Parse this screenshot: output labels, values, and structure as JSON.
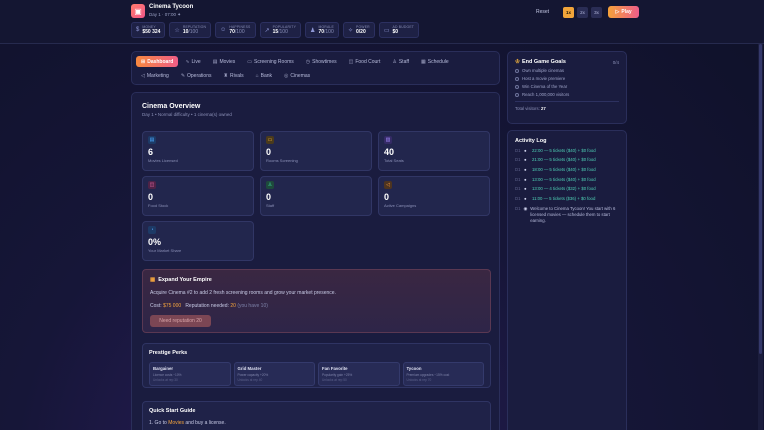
{
  "app": {
    "title": "Cinema Tycoon",
    "subtitle": "Day 1 · 07:00 ✦",
    "logo_icon": "clapperboard-icon"
  },
  "stats": [
    {
      "icon": "money-icon",
      "glyph": "$",
      "label": "MONEY",
      "value": "$50 324",
      "max": ""
    },
    {
      "icon": "star-icon",
      "glyph": "☆",
      "label": "REPUTATION",
      "value": "10",
      "max": "/100"
    },
    {
      "icon": "smile-icon",
      "glyph": "☺",
      "label": "HAPPINESS",
      "value": "70",
      "max": "/100"
    },
    {
      "icon": "trend-icon",
      "glyph": "↗",
      "label": "POPULARITY",
      "value": "15",
      "max": "/100"
    },
    {
      "icon": "morale-icon",
      "glyph": "♟",
      "label": "MORALE",
      "value": "70",
      "max": "/100"
    },
    {
      "icon": "power-icon",
      "glyph": "✧",
      "label": "POWER",
      "value": "0/20",
      "max": ""
    },
    {
      "icon": "budget-icon",
      "glyph": "▭",
      "label": "AD BUDGET",
      "value": "$0",
      "max": ""
    }
  ],
  "controls": {
    "reset": "Reset",
    "speeds": [
      "1x",
      "2x",
      "3x"
    ],
    "active_speed": "1x",
    "play": "Play"
  },
  "nav": {
    "row1": [
      {
        "id": "dashboard",
        "label": "Dashboard",
        "glyph": "⊞",
        "active": true
      },
      {
        "id": "live",
        "label": "Live",
        "glyph": "∿"
      },
      {
        "id": "movies",
        "label": "Movies",
        "glyph": "▤"
      },
      {
        "id": "screening-rooms",
        "label": "Screening Rooms",
        "glyph": "▭"
      },
      {
        "id": "showtimes",
        "label": "Showtimes",
        "glyph": "◷"
      },
      {
        "id": "food-court",
        "label": "Food Court",
        "glyph": "◫"
      },
      {
        "id": "staff",
        "label": "Staff",
        "glyph": "♙"
      },
      {
        "id": "schedule",
        "label": "Schedule",
        "glyph": "▦"
      }
    ],
    "row2": [
      {
        "id": "marketing",
        "label": "Marketing",
        "glyph": "◁"
      },
      {
        "id": "operations",
        "label": "Operations",
        "glyph": "✎"
      },
      {
        "id": "rivals",
        "label": "Rivals",
        "glyph": "♜"
      },
      {
        "id": "bank",
        "label": "Bank",
        "glyph": "⌂"
      },
      {
        "id": "cinemas",
        "label": "Cinemas",
        "glyph": "◎"
      }
    ]
  },
  "overview": {
    "title": "Cinema Overview",
    "subtitle": "Day 1 • Normal difficulty • 1 cinema(s) owned",
    "cards": [
      {
        "icon": "film-icon",
        "glyph": "▤",
        "color": "#4aa8ff",
        "value": "6",
        "label": "Movies Licensed"
      },
      {
        "icon": "screen-icon",
        "glyph": "▭",
        "color": "#f5b53d",
        "value": "0",
        "label": "Rooms Screening"
      },
      {
        "icon": "seats-icon",
        "glyph": "▥",
        "color": "#a58bff",
        "value": "40",
        "label": "Total Seats"
      },
      {
        "icon": "food-icon",
        "glyph": "◫",
        "color": "#ff6fb0",
        "value": "0",
        "label": "Food Stock"
      },
      {
        "icon": "staff-icon",
        "glyph": "♙",
        "color": "#3fd19a",
        "value": "0",
        "label": "Staff"
      },
      {
        "icon": "megaphone-icon",
        "glyph": "◁",
        "color": "#ff9a3d",
        "value": "0",
        "label": "Active Campaigns"
      },
      {
        "icon": "market-icon",
        "glyph": "◔",
        "color": "#5aa8ff",
        "value": "0%",
        "label": "Your Market Share"
      }
    ]
  },
  "expand": {
    "title": "Expand Your Empire",
    "description": "Acquire Cinema #2 to add 2 fresh screening rooms and grow your market presence.",
    "cost_label": "Cost:",
    "cost_value": "$75 000",
    "rep_label": "Reputation needed:",
    "rep_value": "20",
    "rep_have": "(you have 10)",
    "button": "Need reputation 20"
  },
  "perks": {
    "title": "Prestige Perks",
    "items": [
      {
        "name": "Bargainer",
        "desc": "Licence costs −10%",
        "unlock": "Unlocks at rep 30"
      },
      {
        "name": "Grid Master",
        "desc": "Power capacity +20%",
        "unlock": "Unlocks at rep 40"
      },
      {
        "name": "Fan Favorite",
        "desc": "Popularity gain +25%",
        "unlock": "Unlocks at rep 50"
      },
      {
        "name": "Tycoon",
        "desc": "Premium upgrades −15% cost",
        "unlock": "Unlocks at rep 70"
      }
    ]
  },
  "guide": {
    "title": "Quick Start Guide",
    "step_prefix": "1. Go to",
    "step_link": "Movies",
    "step_suffix": "and buy a license."
  },
  "goals": {
    "title": "End Game Goals",
    "count": "0/4",
    "items": [
      "Own multiple cinemas",
      "Host a movie premiere",
      "Win Cinema of the Year",
      "Reach 1,000,000 visitors"
    ],
    "visitors_label": "Total visitors:",
    "visitors_value": "27"
  },
  "log": {
    "title": "Activity Log",
    "entries": [
      {
        "day": "D1",
        "text": "22:00 — 5 tickets ($40) + $0 food"
      },
      {
        "day": "D1",
        "text": "21:00 — 5 tickets ($40) + $0 food"
      },
      {
        "day": "D1",
        "text": "18:00 — 5 tickets ($40) + $0 food"
      },
      {
        "day": "D1",
        "text": "13:00 — 5 tickets ($40) + $0 food"
      },
      {
        "day": "D1",
        "text": "13:00 — 4 tickets ($32) + $0 food"
      },
      {
        "day": "D1",
        "text": "11:00 — 5 tickets ($36) + $0 food"
      },
      {
        "day": "D1",
        "text": "Welcome to Cinema Tycoon! You start with 6 licensed movies — schedule them to start earning.",
        "plain": true
      }
    ]
  }
}
